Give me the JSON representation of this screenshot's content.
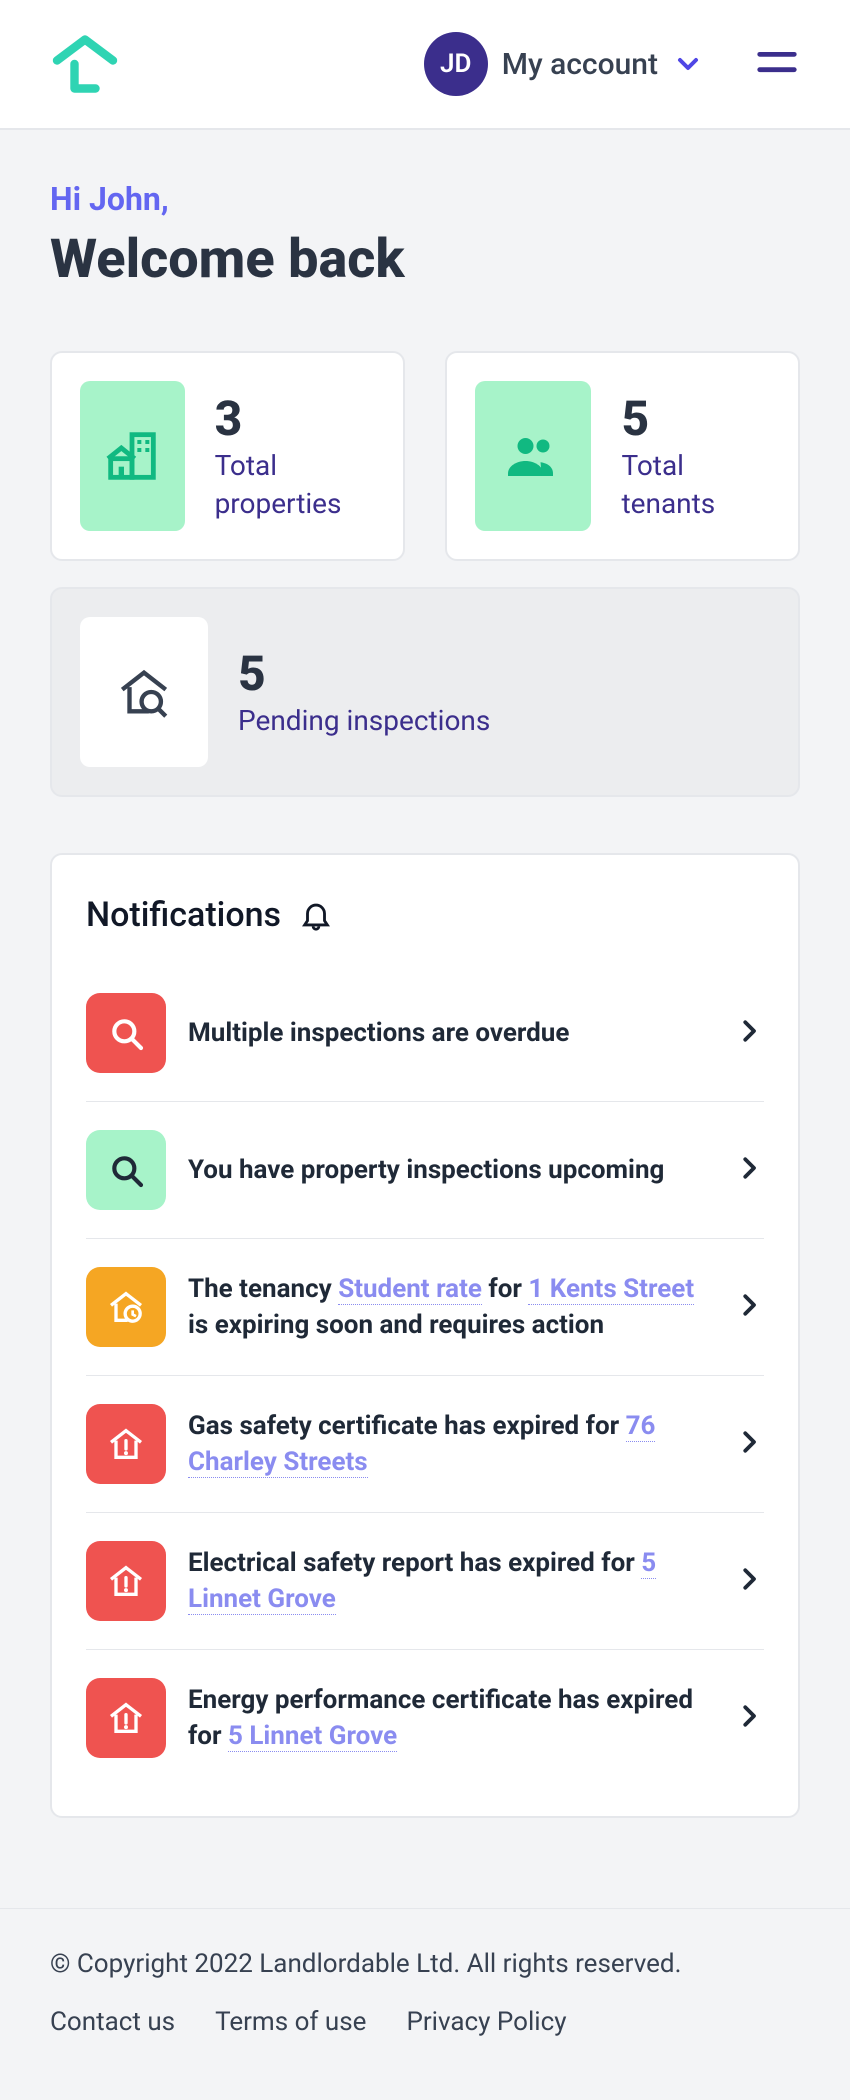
{
  "header": {
    "avatar_initials": "JD",
    "account_label": "My account"
  },
  "greeting": "Hi John,",
  "welcome": "Welcome back",
  "stats": {
    "properties": {
      "value": "3",
      "label": "Total properties"
    },
    "tenants": {
      "value": "5",
      "label": "Total tenants"
    },
    "pending": {
      "value": "5",
      "label": "Pending inspections"
    }
  },
  "notifications": {
    "title": "Notifications",
    "items": [
      {
        "icon": "search",
        "color": "red",
        "parts": [
          {
            "t": "Multiple inspections are overdue"
          }
        ]
      },
      {
        "icon": "search",
        "color": "green",
        "parts": [
          {
            "t": "You have property inspections upcoming"
          }
        ]
      },
      {
        "icon": "house-clock",
        "color": "amber",
        "parts": [
          {
            "t": "The tenancy "
          },
          {
            "t": "Student rate",
            "link": true
          },
          {
            "t": " for "
          },
          {
            "t": "1 Kents Street",
            "link": true
          },
          {
            "t": " is expiring soon and requires action"
          }
        ]
      },
      {
        "icon": "house-alert",
        "color": "red",
        "parts": [
          {
            "t": "Gas safety certificate has expired for "
          },
          {
            "t": "76 Charley Streets",
            "link": true
          }
        ]
      },
      {
        "icon": "house-alert",
        "color": "red",
        "parts": [
          {
            "t": "Electrical safety report has expired for "
          },
          {
            "t": "5 Linnet Grove",
            "link": true
          }
        ]
      },
      {
        "icon": "house-alert",
        "color": "red",
        "parts": [
          {
            "t": "Energy performance certificate has expired for "
          },
          {
            "t": "5 Linnet Grove",
            "link": true
          }
        ]
      }
    ]
  },
  "footer": {
    "copyright": "© Copyright 2022 Landlordable Ltd. All rights reserved.",
    "links": [
      "Contact us",
      "Terms of use",
      "Privacy Policy"
    ]
  },
  "colors": {
    "accent": "#2fd4b3",
    "avatar": "#3b2e8c",
    "green_bg": "#a7f3c9",
    "red": "#ef5350",
    "amber": "#f5a623",
    "link": "#8a8cf0"
  }
}
